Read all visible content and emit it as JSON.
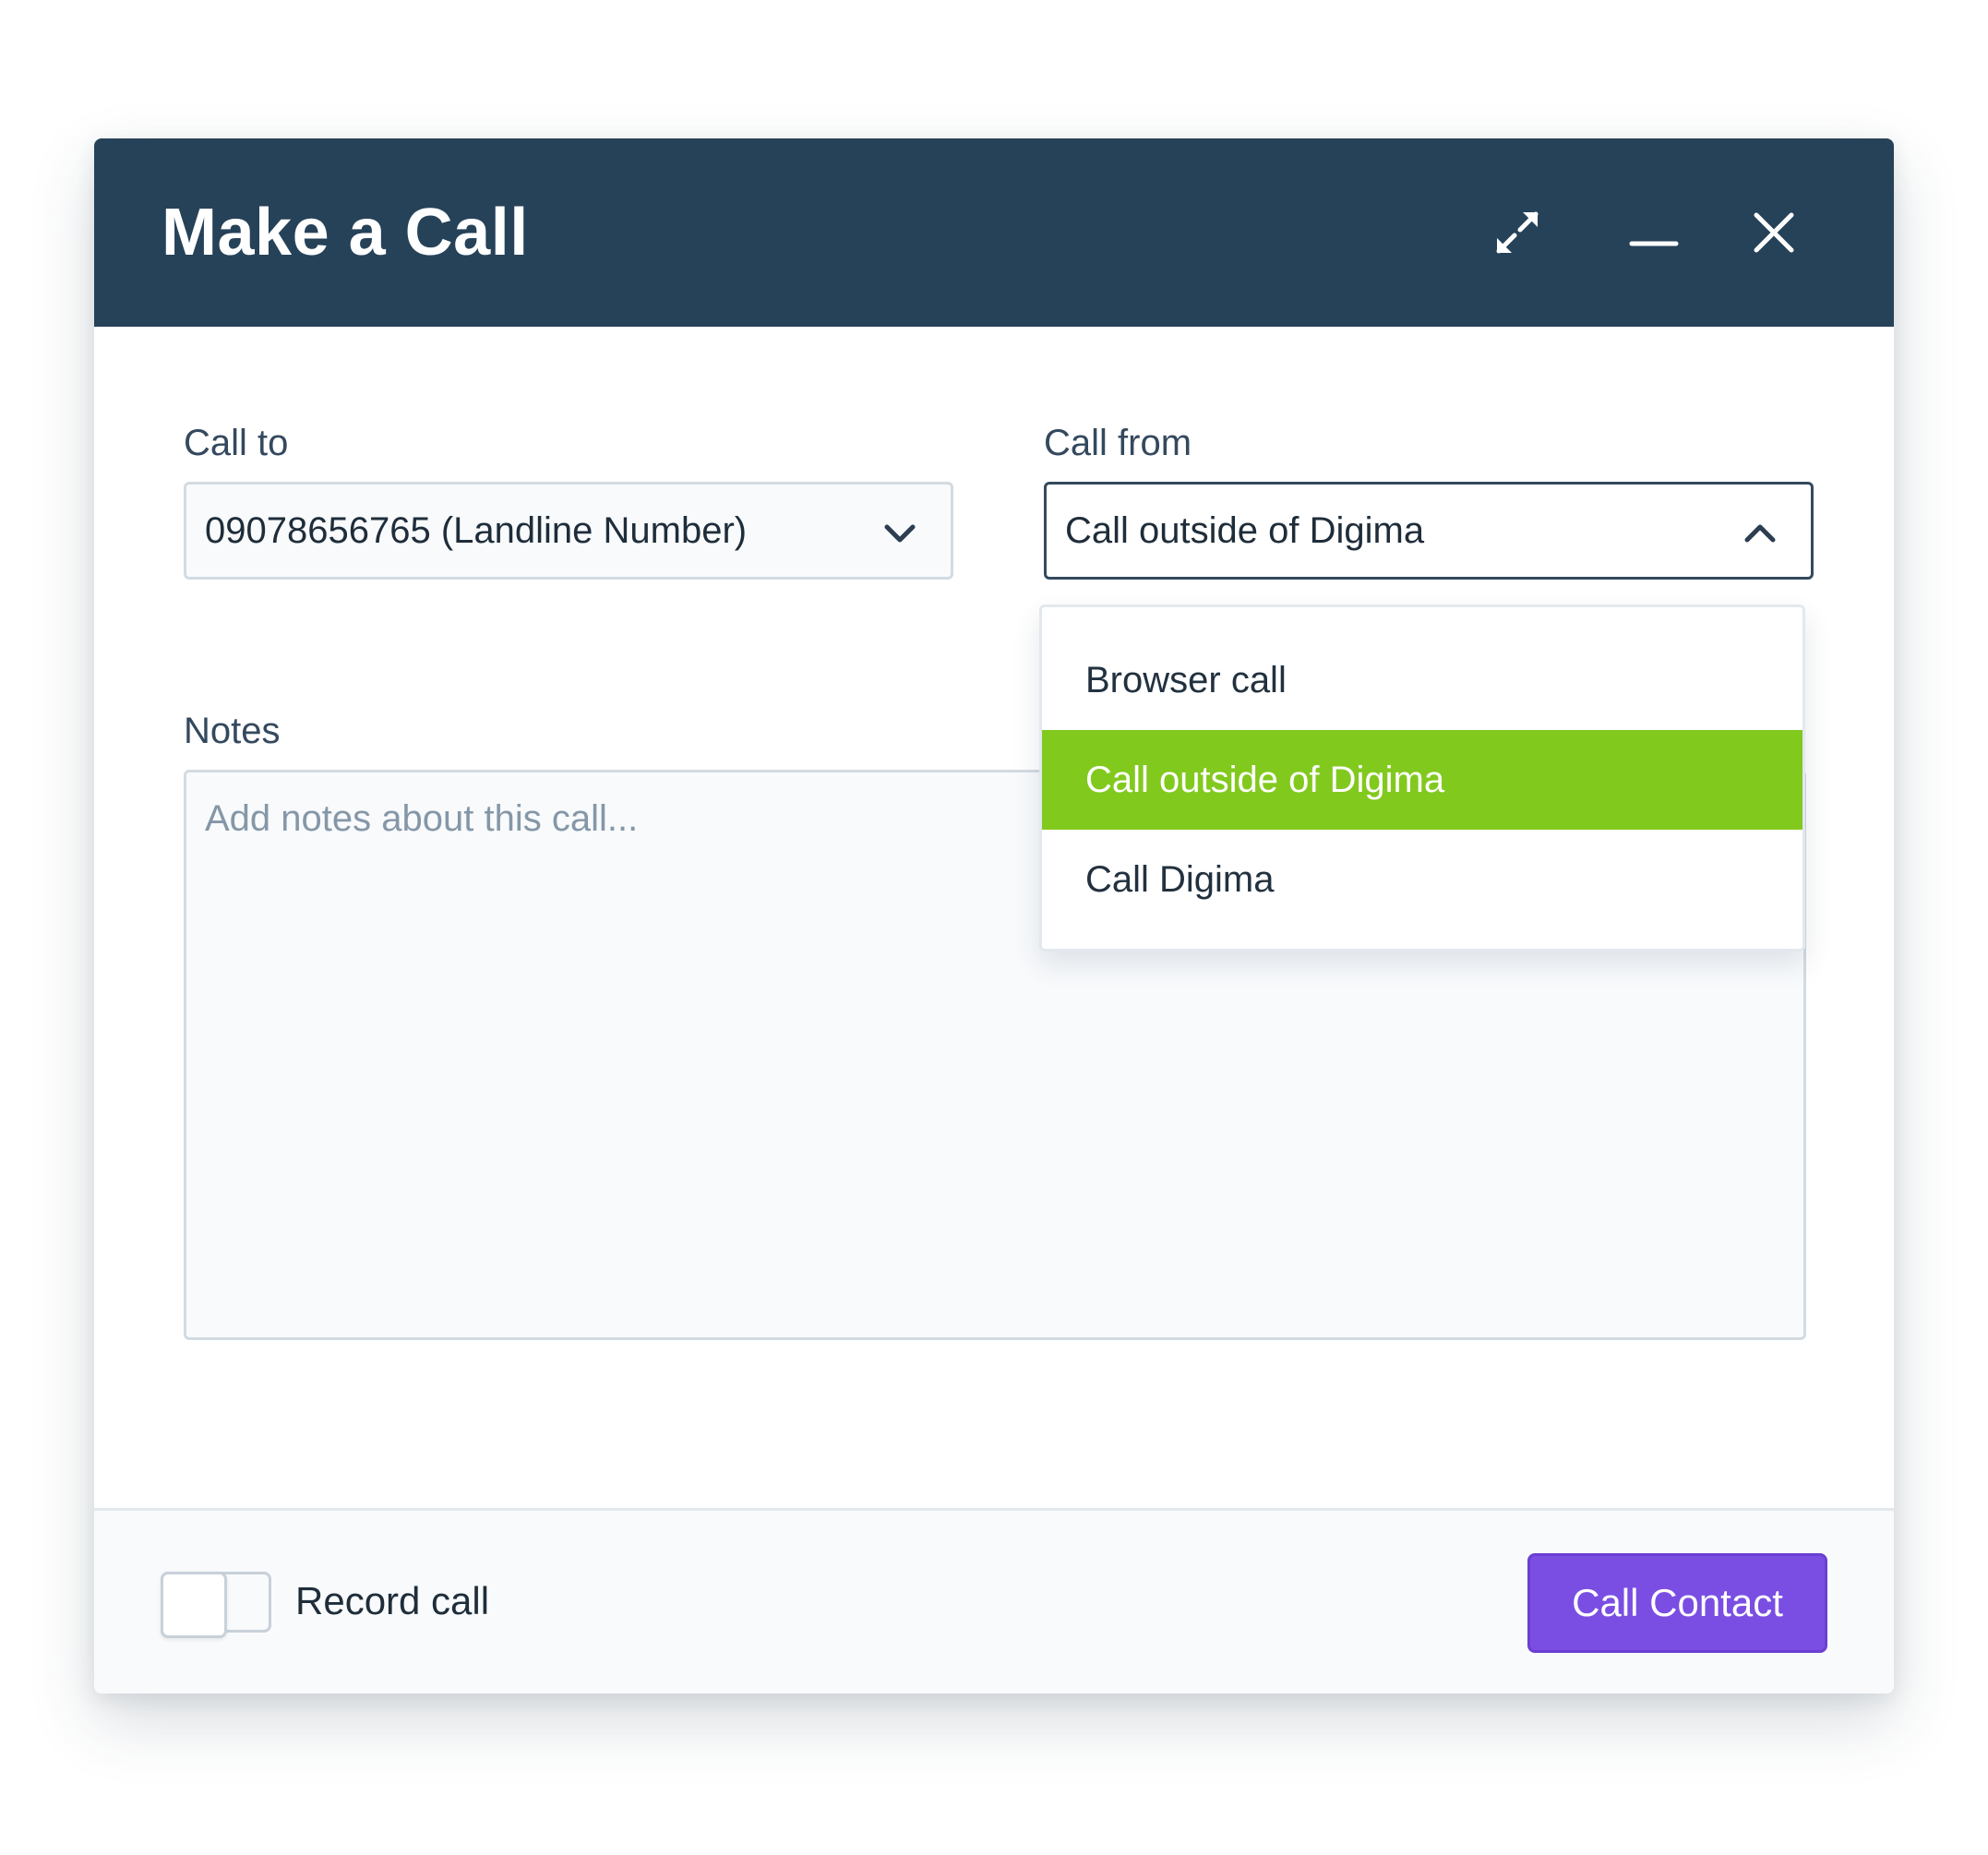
{
  "dialog": {
    "title": "Make a Call",
    "icons": {
      "expand": "expand-icon",
      "minimize": "minimize-icon",
      "close": "close-icon"
    }
  },
  "call_to": {
    "label": "Call to",
    "value": "09078656765 (Landline Number)"
  },
  "call_from": {
    "label": "Call from",
    "value": "Call outside of Digima",
    "expanded": true,
    "options": [
      {
        "label": "Browser call",
        "selected": false
      },
      {
        "label": "Call outside of Digima",
        "selected": true
      },
      {
        "label": "Call Digima",
        "selected": false
      }
    ]
  },
  "notes": {
    "label": "Notes",
    "placeholder": "Add notes about this call..."
  },
  "footer": {
    "record_call_label": "Record call",
    "record_call_on": false,
    "call_button_label": "Call Contact"
  },
  "colors": {
    "header_bg": "#264259",
    "selected_option": "#82c91e",
    "primary_button": "#7a4ee3"
  }
}
